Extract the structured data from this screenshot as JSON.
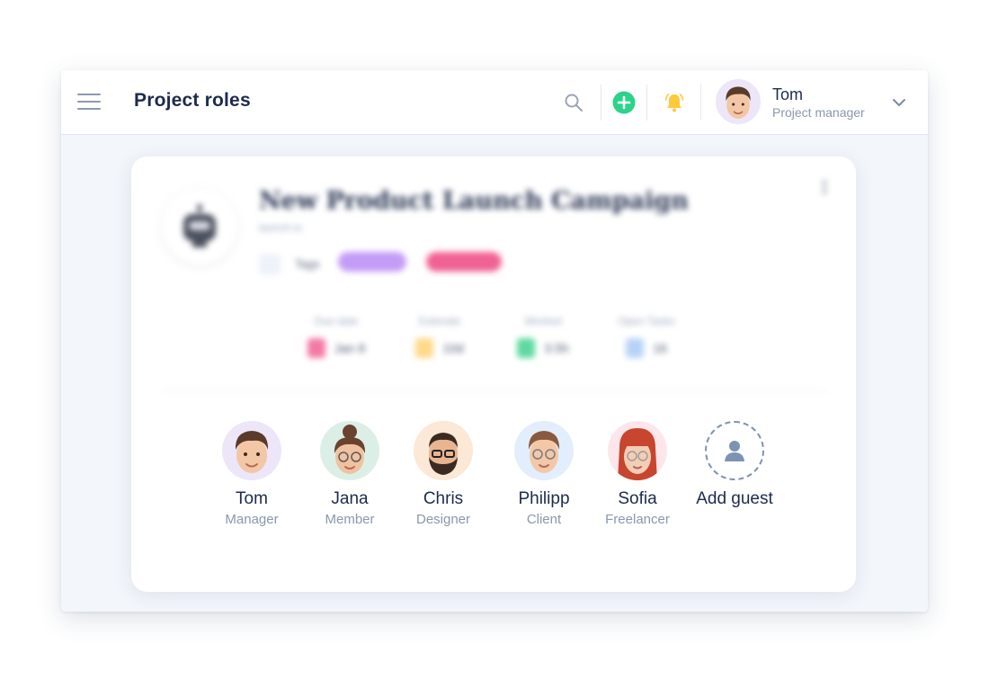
{
  "header": {
    "title": "Project roles",
    "user": {
      "name": "Tom",
      "role": "Project manager"
    }
  },
  "colors": {
    "accent_green": "#2bd38a",
    "bell_yellow": "#ffc93c",
    "tag_purple": "#c39cf6",
    "tag_pink": "#f06293"
  },
  "project": {
    "title": "New Product Launch Campaign",
    "subtitle": "launch.io",
    "tags_label": "Tags"
  },
  "stats": [
    {
      "label": "Due date",
      "value": "Jan 8",
      "icon": "calendar-icon",
      "color": "#f27aa5"
    },
    {
      "label": "Estimate",
      "value": "10d",
      "icon": "hourglass-icon",
      "color": "#ffd88a"
    },
    {
      "label": "Worked",
      "value": "3.5h",
      "icon": "check-icon",
      "color": "#5fd9a0"
    },
    {
      "label": "Open Tasks",
      "value": "16",
      "icon": "document-icon",
      "color": "#b6d3f7"
    }
  ],
  "members": [
    {
      "name": "Tom",
      "role": "Manager",
      "bg": "#ece6f8"
    },
    {
      "name": "Jana",
      "role": "Member",
      "bg": "#dcefe7"
    },
    {
      "name": "Chris",
      "role": "Designer",
      "bg": "#fbe8d6"
    },
    {
      "name": "Philipp",
      "role": "Client",
      "bg": "#e2eefc"
    },
    {
      "name": "Sofia",
      "role": "Freelancer",
      "bg": "#fde6ea"
    }
  ],
  "guest": {
    "label": "Add guest",
    "icon": "person-icon"
  }
}
